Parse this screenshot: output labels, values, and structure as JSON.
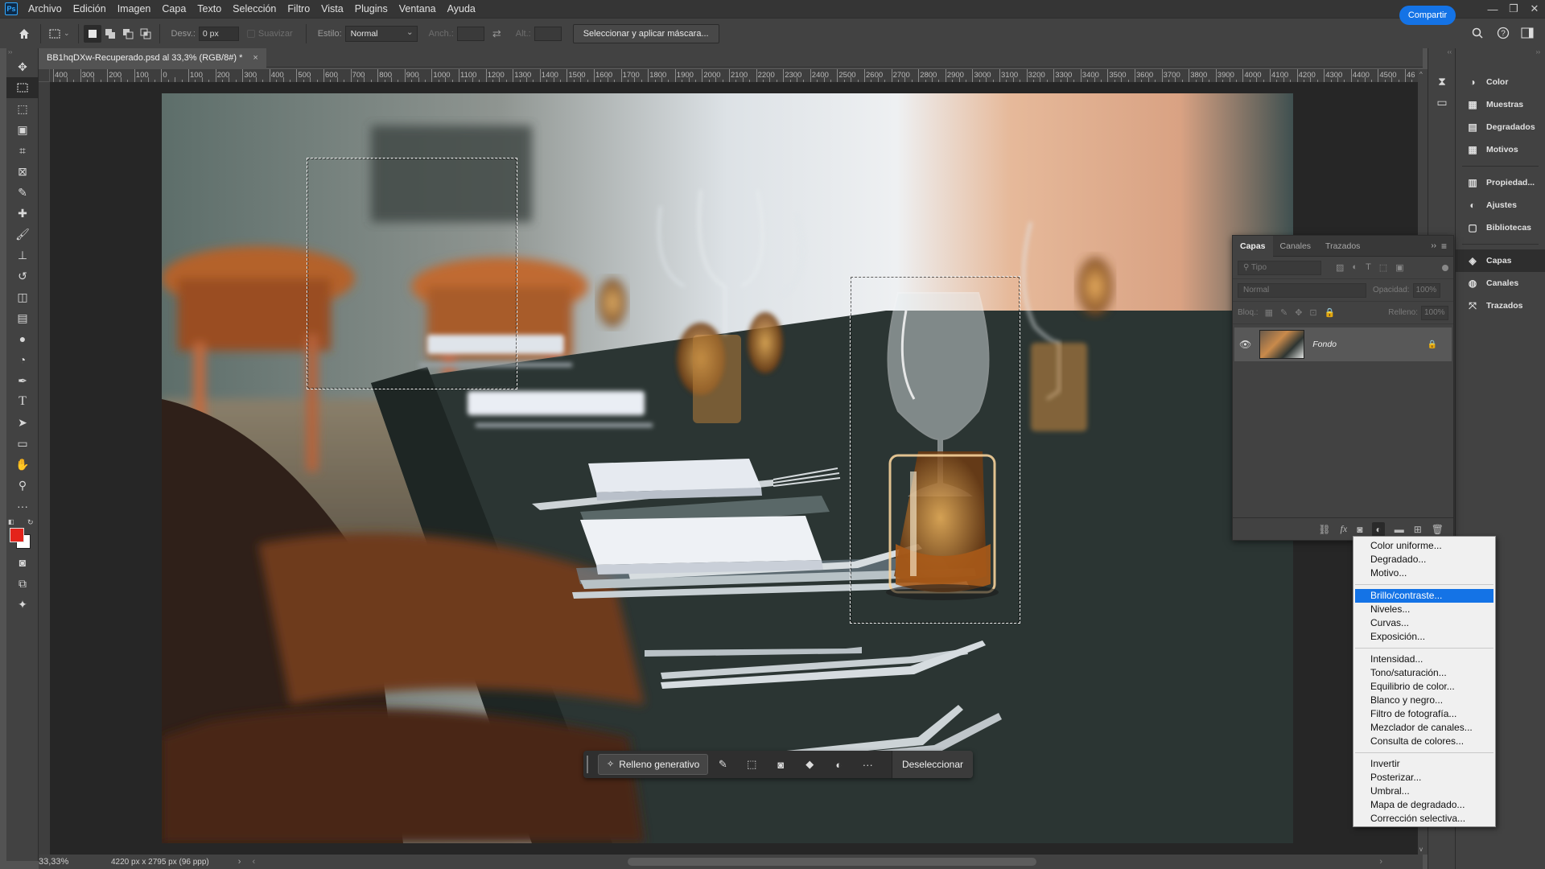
{
  "app": {
    "logo": "Ps"
  },
  "menu": [
    "Archivo",
    "Edición",
    "Imagen",
    "Capa",
    "Texto",
    "Selección",
    "Filtro",
    "Vista",
    "Plugins",
    "Ventana",
    "Ayuda"
  ],
  "options": {
    "feather_label": "Desv.:",
    "feather_value": "0 px",
    "smooth_label": "Suavizar",
    "style_label": "Estilo:",
    "style_value": "Normal",
    "width_label": "Anch.:",
    "height_label": "Alt.:",
    "mask_button": "Seleccionar y aplicar máscara...",
    "share_button": "Compartir"
  },
  "document": {
    "tab_title": "BB1hqDXw-Recuperado.psd al 33,3% (RGB/8#) *",
    "tab_close": "×"
  },
  "ruler": {
    "top_labels": [
      "400",
      "300",
      "200",
      "100",
      "0",
      "100",
      "200",
      "300",
      "400",
      "500",
      "600",
      "700",
      "800",
      "900",
      "1000",
      "1100",
      "1200",
      "1300",
      "1400",
      "1500",
      "1600",
      "1700",
      "1800",
      "1900",
      "2000",
      "2100",
      "2200",
      "2300",
      "2400",
      "2500",
      "2600",
      "2700",
      "2800",
      "2900",
      "3000",
      "3100",
      "3200",
      "3300",
      "3400",
      "3500",
      "3600",
      "3700",
      "3800",
      "3900",
      "4000",
      "4100",
      "4200",
      "4300",
      "4400",
      "4500",
      "46"
    ]
  },
  "context_bar": {
    "generative_fill": "Relleno generativo",
    "deselect": "Deseleccionar"
  },
  "status": {
    "zoom": "33,33%",
    "doc_info": "4220 px x 2795 px (96 ppp)"
  },
  "right_panel": {
    "group1": [
      {
        "label": "Color",
        "icon": "color-icon"
      },
      {
        "label": "Muestras",
        "icon": "swatches-icon"
      },
      {
        "label": "Degradados",
        "icon": "gradients-icon"
      },
      {
        "label": "Motivos",
        "icon": "patterns-icon"
      }
    ],
    "group2": [
      {
        "label": "Propiedad...",
        "icon": "properties-icon"
      },
      {
        "label": "Ajustes",
        "icon": "adjustments-icon"
      },
      {
        "label": "Bibliotecas",
        "icon": "libraries-icon"
      }
    ],
    "group3": [
      {
        "label": "Capas",
        "icon": "layers-icon"
      },
      {
        "label": "Canales",
        "icon": "channels-icon"
      },
      {
        "label": "Trazados",
        "icon": "paths-icon"
      }
    ]
  },
  "layers_panel": {
    "tabs": [
      "Capas",
      "Canales",
      "Trazados"
    ],
    "filter_placeholder": "Tipo",
    "blend_mode": "Normal",
    "opacity_label": "Opacidad:",
    "opacity_value": "100%",
    "lock_label": "Bloq.:",
    "fill_label": "Relleno:",
    "fill_value": "100%",
    "layer_name": "Fondo"
  },
  "adjust_menu": {
    "group1": [
      "Color uniforme...",
      "Degradado...",
      "Motivo..."
    ],
    "group2": [
      "Brillo/contraste...",
      "Niveles...",
      "Curvas...",
      "Exposición..."
    ],
    "group3": [
      "Intensidad...",
      "Tono/saturación...",
      "Equilibrio de color...",
      "Blanco y negro...",
      "Filtro de fotografía...",
      "Mezclador de canales...",
      "Consulta de colores..."
    ],
    "group4": [
      "Invertir",
      "Posterizar...",
      "Umbral...",
      "Mapa de degradado...",
      "Corrección selectiva..."
    ],
    "selected": "Brillo/contraste..."
  },
  "colors": {
    "accent": "#1473e6",
    "foreground": "#e4231b",
    "background": "#ffffff"
  }
}
